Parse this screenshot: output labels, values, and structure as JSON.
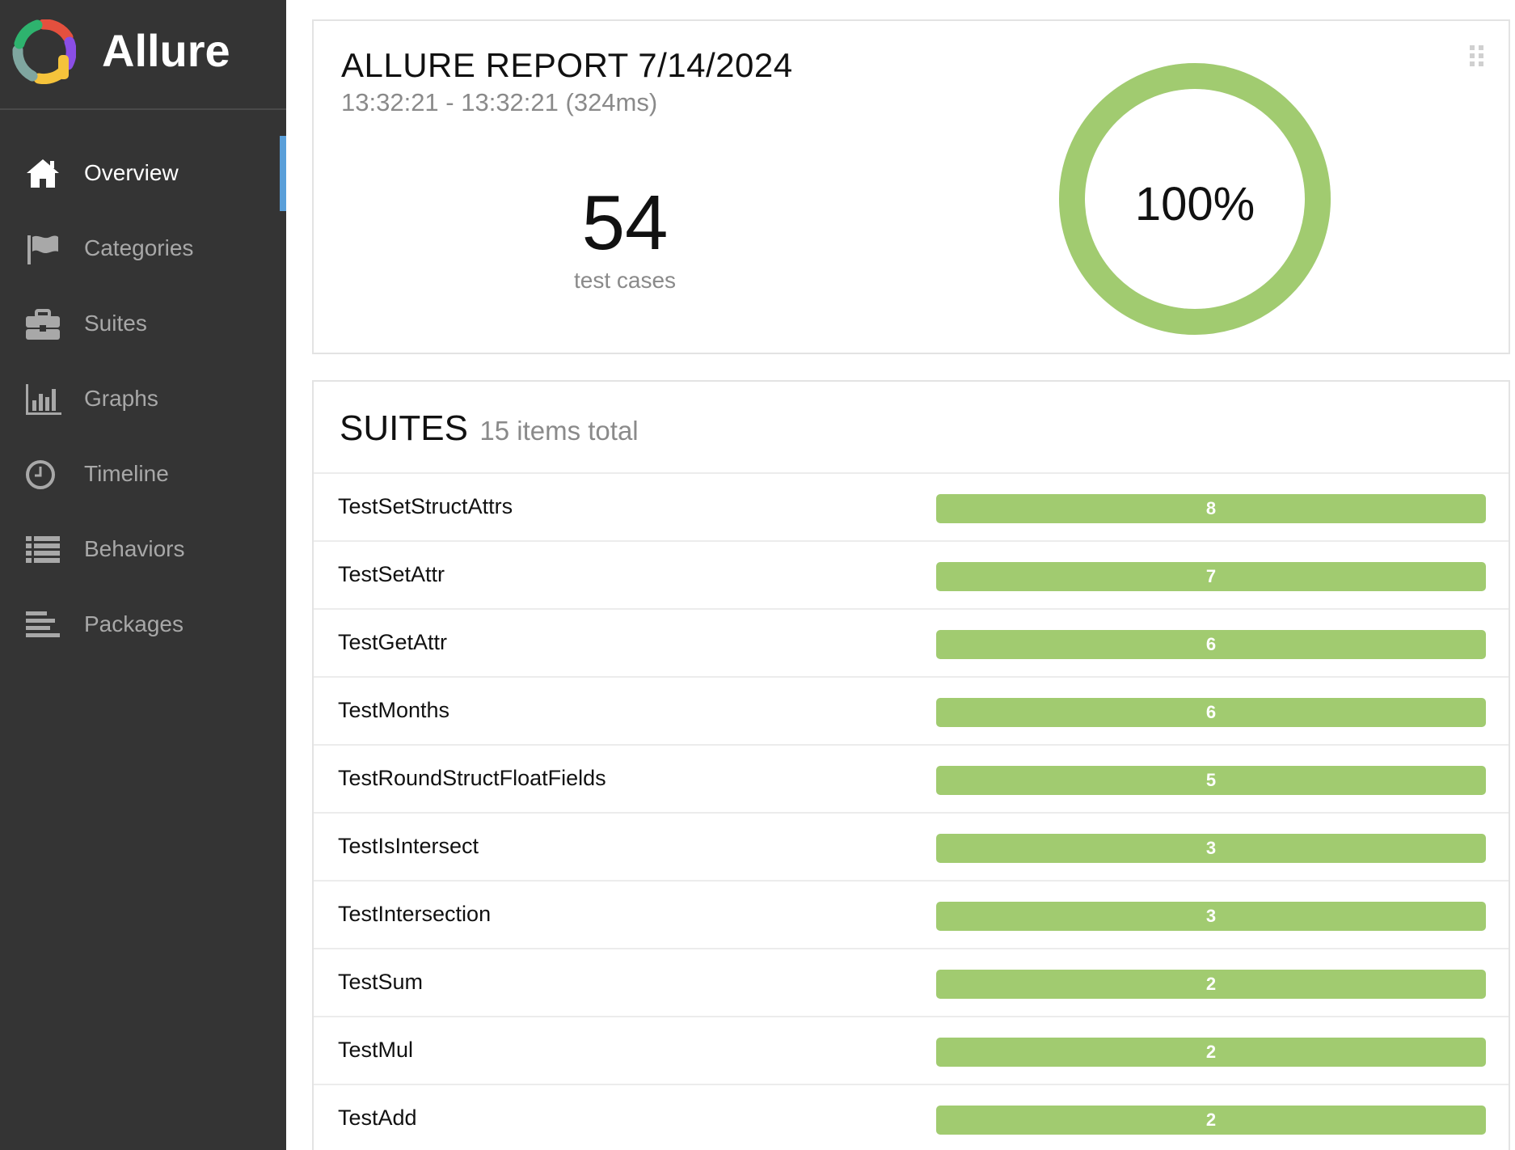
{
  "brand": {
    "name": "Allure",
    "logo_icon": "allure-logo-icon"
  },
  "nav": {
    "items": [
      {
        "label": "Overview",
        "icon": "home-icon",
        "active": true
      },
      {
        "label": "Categories",
        "icon": "flag-icon",
        "active": false
      },
      {
        "label": "Suites",
        "icon": "briefcase-icon",
        "active": false
      },
      {
        "label": "Graphs",
        "icon": "bar-chart-icon",
        "active": false
      },
      {
        "label": "Timeline",
        "icon": "clock-icon",
        "active": false
      },
      {
        "label": "Behaviors",
        "icon": "list-icon",
        "active": false
      },
      {
        "label": "Packages",
        "icon": "align-left-icon",
        "active": false
      }
    ],
    "active_color": "#5a9fd9"
  },
  "summary": {
    "title": "ALLURE REPORT 7/14/2024",
    "subtitle": "13:32:21 - 13:32:21 (324ms)",
    "test_count": "54",
    "test_count_label": "test cases",
    "success_rate": "100%",
    "success_fraction": 1.0,
    "success_color": "#a1cb70"
  },
  "suites": {
    "title": "SUITES",
    "count_text": "15 items total",
    "bar_color": "#a1cb70",
    "items": [
      {
        "name": "TestSetStructAttrs",
        "count": 8
      },
      {
        "name": "TestSetAttr",
        "count": 7
      },
      {
        "name": "TestGetAttr",
        "count": 6
      },
      {
        "name": "TestMonths",
        "count": 6
      },
      {
        "name": "TestRoundStructFloatFields",
        "count": 5
      },
      {
        "name": "TestIsIntersect",
        "count": 3
      },
      {
        "name": "TestIntersection",
        "count": 3
      },
      {
        "name": "TestSum",
        "count": 2
      },
      {
        "name": "TestMul",
        "count": 2
      },
      {
        "name": "TestAdd",
        "count": 2
      }
    ]
  }
}
